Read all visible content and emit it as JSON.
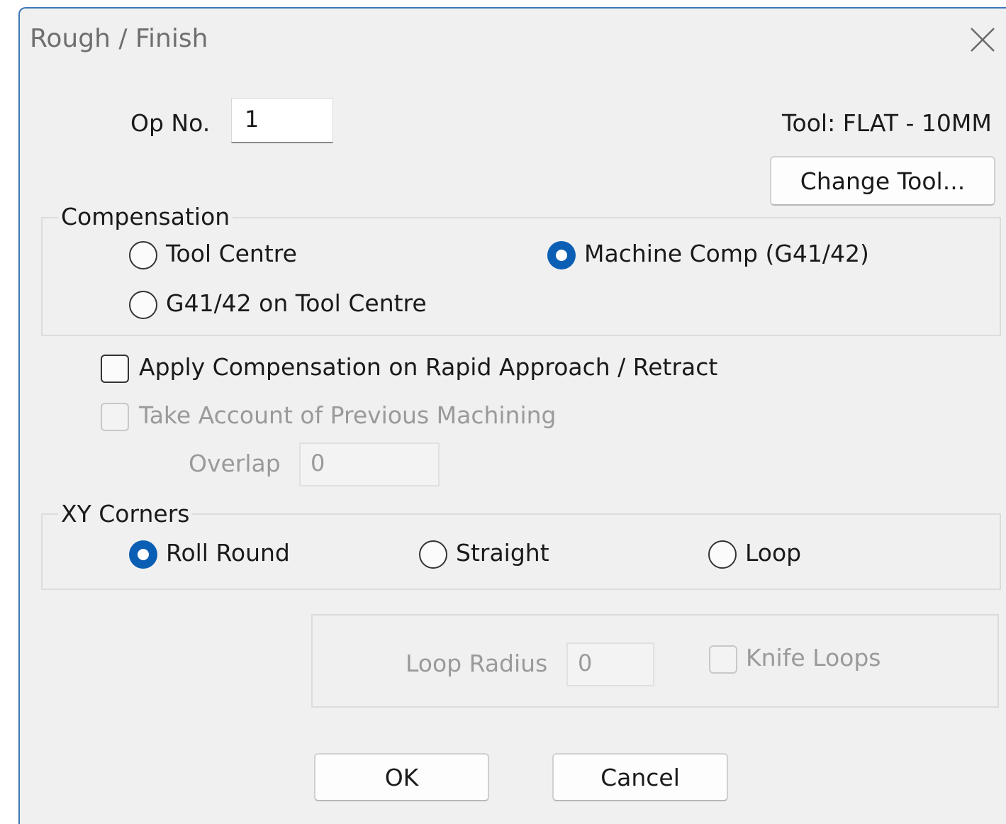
{
  "window": {
    "title": "Rough / Finish"
  },
  "op": {
    "label": "Op No.",
    "value": "1"
  },
  "tool": {
    "label": "Tool: FLAT - 10MM",
    "change_button": "Change Tool..."
  },
  "compensation": {
    "legend": "Compensation",
    "options": [
      "Tool Centre",
      "Machine Comp (G41/42)",
      "G41/42 on Tool Centre"
    ],
    "selected": "Machine Comp (G41/42)"
  },
  "options": {
    "apply_comp_label": "Apply Compensation on Rapid Approach / Retract",
    "apply_comp_checked": false,
    "previous_machining_label": "Take Account of Previous Machining",
    "previous_machining_checked": false,
    "overlap_label": "Overlap",
    "overlap_value": "0"
  },
  "xy_corners": {
    "legend": "XY Corners",
    "options": [
      "Roll Round",
      "Straight",
      "Loop"
    ],
    "selected": "Roll Round"
  },
  "loop": {
    "radius_label": "Loop Radius",
    "radius_value": "0",
    "knife_loops_label": "Knife Loops",
    "knife_loops_checked": false
  },
  "buttons": {
    "ok": "OK",
    "cancel": "Cancel"
  }
}
